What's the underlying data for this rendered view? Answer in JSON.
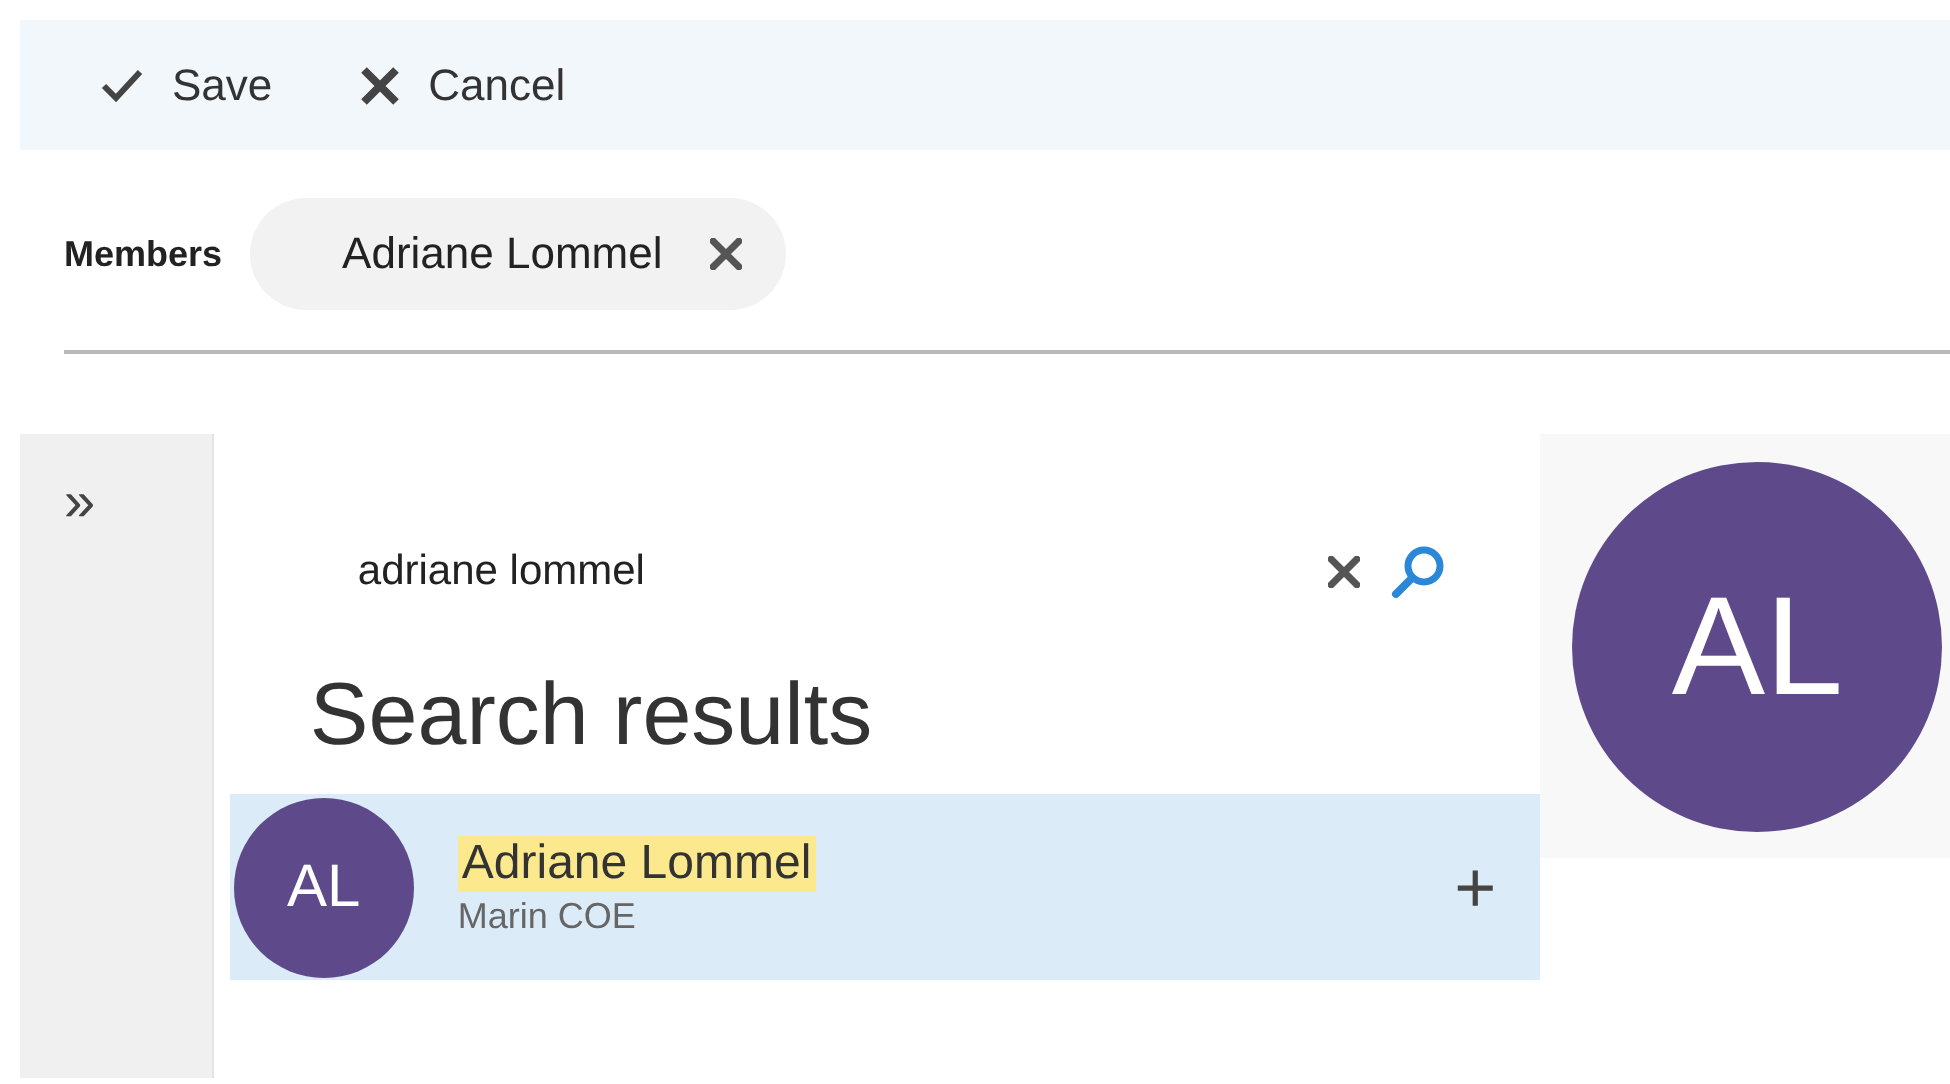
{
  "toolbar": {
    "save": "Save",
    "cancel": "Cancel"
  },
  "members": {
    "label": "Members",
    "chips": [
      {
        "name": "Adriane Lommel"
      }
    ]
  },
  "sidebar": {
    "expand": "»"
  },
  "search": {
    "value": "adriane lommel"
  },
  "results": {
    "heading": "Search results",
    "items": [
      {
        "initials": "AL",
        "name": "Adriane Lommel",
        "detail": "Marin COE",
        "selected": true,
        "highlighted": true,
        "action": "+"
      }
    ]
  },
  "profile": {
    "initials": "AL"
  }
}
